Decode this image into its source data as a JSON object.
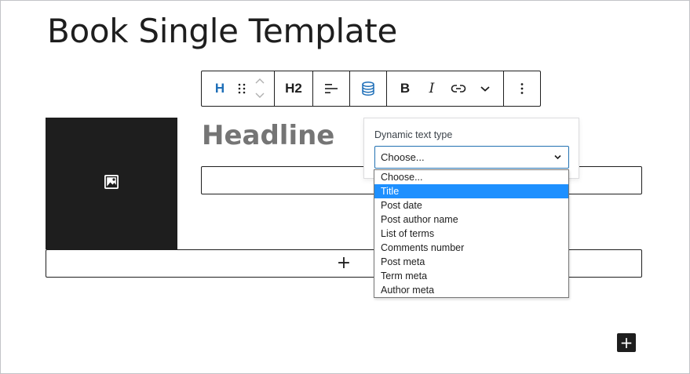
{
  "page": {
    "title": "Book Single Template"
  },
  "toolbar": {
    "block_type_label": "H",
    "heading_level_label": "H2",
    "bold_label": "B",
    "italic_label": "I"
  },
  "block": {
    "headline_placeholder": "Headline"
  },
  "dynamic_text": {
    "label": "Dynamic text type",
    "selected_value": "Choose...",
    "options": [
      "Choose...",
      "Title",
      "Post date",
      "Post author name",
      "List of terms",
      "Comments number",
      "Post meta",
      "Term meta",
      "Author meta"
    ],
    "highlighted_index": 1
  },
  "appender": {
    "plus_symbol": "+"
  },
  "colors": {
    "accent": "#1e6fb8",
    "highlight": "#1e90ff",
    "dark": "#1e1e1e"
  }
}
